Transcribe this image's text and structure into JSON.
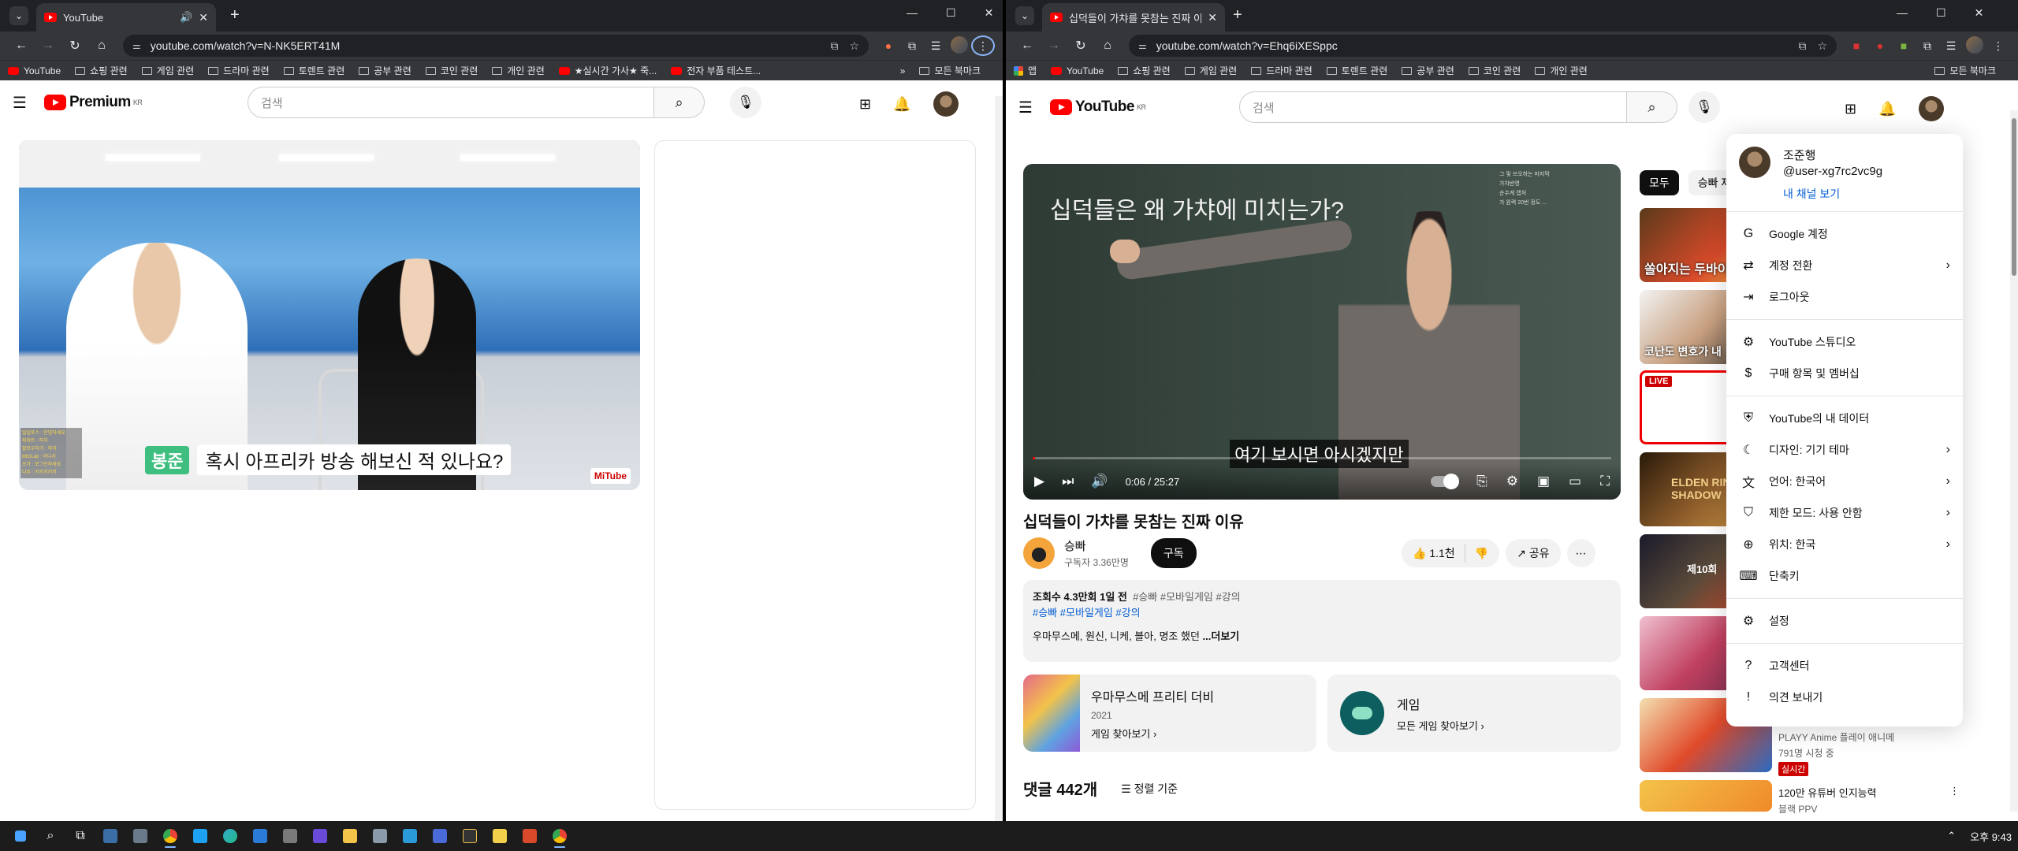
{
  "left": {
    "tab_title": "YouTube",
    "url": "youtube.com/watch?v=N-NK5ERT41M",
    "bookmarks": [
      "YouTube",
      "쇼핑 관련",
      "게임 관련",
      "드라마 관련",
      "토렌트 관련",
      "공부 관련",
      "코인 관련",
      "개인 관련",
      "★실시간 가사★ 죽...",
      "전자 부품 테스트..."
    ],
    "bookmarks_more": "»",
    "all_bookmarks": "모든 북마크",
    "logo": "Premium",
    "region": "KR",
    "search_placeholder": "검색",
    "video": {
      "speaker": "봉준",
      "subtitle": "혹시 아프리카 방송 해보신 적 있나요?",
      "watermark": "MiTube",
      "chat_lines": [
        "일일포스 : 안녕하세요",
        "파워트 : 하하",
        "팔로우하기 : 하하",
        "MIOLab : 어디서",
        "오가 : 로그인하세요",
        "다주 : 키키키키키"
      ]
    }
  },
  "right": {
    "tab_title": "십덕들이 가챠를 못참는 진짜 이유",
    "url": "youtube.com/watch?v=Ehq6iXESppc",
    "apps_label": "앱",
    "bookmarks": [
      "YouTube",
      "쇼핑 관련",
      "게임 관련",
      "드라마 관련",
      "토렌트 관련",
      "공부 관련",
      "코인 관련",
      "개인 관련"
    ],
    "all_bookmarks": "모든 북마크",
    "logo": "YouTube",
    "region": "KR",
    "search_placeholder": "검색",
    "video": {
      "board_title": "십덕들은 왜 가챠에 미치는가?",
      "subtitle": "여기 보시면 아시겠지만",
      "time": "0:06 / 25:27",
      "progress": 0.004,
      "notes": [
        "그 및 쓰오하는 마지막",
        "가챠반영",
        "순수게 캡처",
        "가 원력 20번 정도 …"
      ]
    },
    "title": "십덕들이 가챠를 못참는 진짜 이유",
    "channel": {
      "name": "승빠",
      "subs": "구독자 3.36만명",
      "subscribe": "구독"
    },
    "likes": "1.1천",
    "share": "공유",
    "desc": {
      "meta": "조회수 4.3만회  1일 전",
      "meta_tags": "#승빠 #모바일게임 #강의",
      "tags": "#승빠 #모바일게임 #강의",
      "text": "우마무스메, 원신, 니케, 블아, 명조 했던 ",
      "more": "...더보기"
    },
    "card_game": {
      "title": "우마무스메 프리티 더비",
      "year": "2021",
      "link": "게임 찾아보기 ›"
    },
    "card_cat": {
      "title": "게임",
      "link": "모든 게임 찾아보기 ›"
    },
    "comments": {
      "count": "댓글 442개",
      "sort": "정렬 기준"
    },
    "chips": [
      "모두",
      "승빠 제"
    ],
    "recs": [
      {
        "overlay": "쏠아지는 두바이 초콜",
        "live": ""
      },
      {
        "overlay": "코난도 변호가 내",
        "live": ""
      },
      {
        "overlay": "",
        "live": "LIVE"
      },
      {
        "overlay": "ELDEN RING SHADOW",
        "live": ""
      },
      {
        "overlay": "제10회",
        "live": ""
      },
      {
        "overlay": "",
        "live": ""
      },
      {
        "overlay": "",
        "live": ""
      },
      {
        "overlay": "",
        "live": ""
      }
    ],
    "rec_text": {
      "channel": "PLAYY Anime 플레이 애니메",
      "viewers": "791명 시청 중",
      "badge": "실시간",
      "next_title": "120만 유튜버 인지능력",
      "next_channel": "블랙 PPV"
    },
    "menu": {
      "name": "조준행",
      "handle": "@user-xg7rc2vc9g",
      "channel_link": "내 채널 보기",
      "sections": [
        [
          {
            "label": "Google 계정",
            "icon": "G"
          },
          {
            "label": "계정 전환",
            "icon": "⇄",
            "chev": true
          },
          {
            "label": "로그아웃",
            "icon": "⇥"
          }
        ],
        [
          {
            "label": "YouTube 스튜디오",
            "icon": "⚙"
          },
          {
            "label": "구매 항목 및 멤버십",
            "icon": "$"
          }
        ],
        [
          {
            "label": "YouTube의 내 데이터",
            "icon": "⛨"
          },
          {
            "label": "디자인: 기기 테마",
            "icon": "☾",
            "chev": true
          },
          {
            "label": "언어: 한국어",
            "icon": "文",
            "chev": true
          },
          {
            "label": "제한 모드: 사용 안함",
            "icon": "⛉",
            "chev": true
          },
          {
            "label": "위치: 한국",
            "icon": "⊕",
            "chev": true
          },
          {
            "label": "단축키",
            "icon": "⌨"
          }
        ],
        [
          {
            "label": "설정",
            "icon": "⚙"
          }
        ],
        [
          {
            "label": "고객센터",
            "icon": "?"
          },
          {
            "label": "의견 보내기",
            "icon": "!"
          }
        ]
      ]
    }
  },
  "taskbar": {
    "time": "오후 9:43"
  }
}
